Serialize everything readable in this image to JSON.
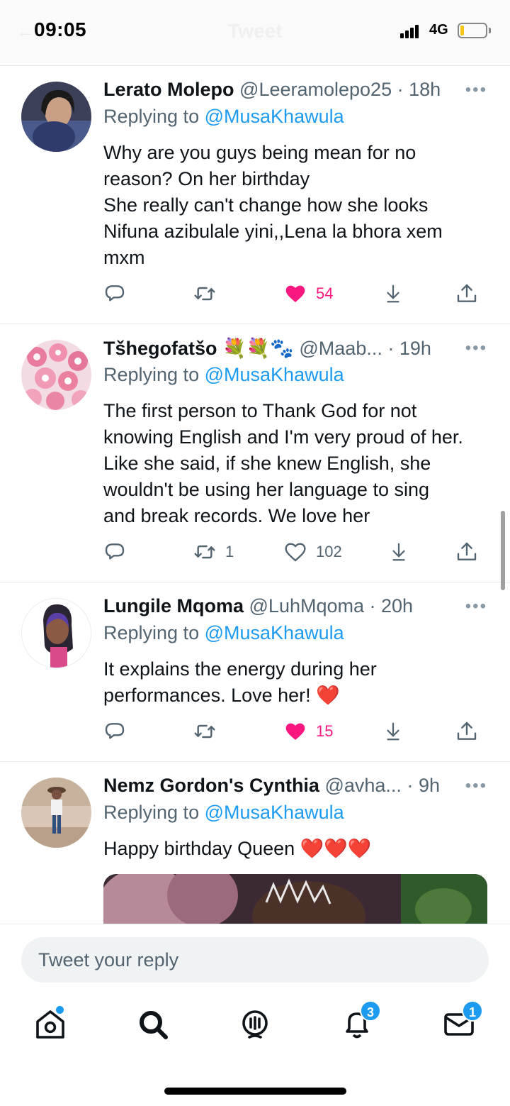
{
  "status_bar": {
    "time": "09:05",
    "network": "4G",
    "title": "Tweet",
    "back": "←"
  },
  "tweets": [
    {
      "name": "Lerato Molepo",
      "handle": "@Leeramolepo25",
      "time": "· 18h",
      "replying_prefix": "Replying to",
      "replying_to": "@MusaKhawula",
      "lines": [
        "Why are you guys being mean for no",
        "reason? On her birthday",
        "She really can't change how she looks",
        "Nifuna azibulale yini,,Lena la bhora xem",
        "mxm"
      ],
      "retweets": "",
      "likes": "54",
      "liked": true
    },
    {
      "name": "Tšhegofatšo 💐💐🐾",
      "handle": "@Maab...",
      "time": "· 19h",
      "replying_prefix": "Replying to",
      "replying_to": "@MusaKhawula",
      "lines": [
        "The first person to Thank God for not",
        "knowing English and I'm very proud of her.",
        "Like she said, if she knew English, she",
        "wouldn't be using her language to sing",
        "and break records. We love her"
      ],
      "retweets": "1",
      "likes": "102",
      "liked": false
    },
    {
      "name": "Lungile Mqoma",
      "handle": "@LuhMqoma",
      "time": "· 20h",
      "replying_prefix": "Replying to",
      "replying_to": "@MusaKhawula",
      "lines": [
        "It explains the energy during her",
        "performances. Love her! ❤️"
      ],
      "retweets": "",
      "likes": "15",
      "liked": true
    },
    {
      "name": "Nemz Gordon's Cynthia",
      "handle": "@avha...",
      "time": "· 9h",
      "replying_prefix": "Replying to",
      "replying_to": "@MusaKhawula",
      "lines": [
        "Happy birthday Queen ❤️❤️❤️"
      ]
    }
  ],
  "reply_box": {
    "placeholder": "Tweet your reply"
  },
  "nav": {
    "notifications_badge": "3",
    "messages_badge": "1"
  },
  "colors": {
    "accent": "#1d9bf0",
    "like": "#f91880",
    "text": "#0f1419",
    "secondary": "#536471"
  },
  "icons": [
    "more-icon",
    "reply-icon",
    "retweet-icon",
    "like-icon",
    "share-icon",
    "home-icon",
    "search-icon",
    "spaces-icon",
    "notifications-icon",
    "messages-icon"
  ]
}
